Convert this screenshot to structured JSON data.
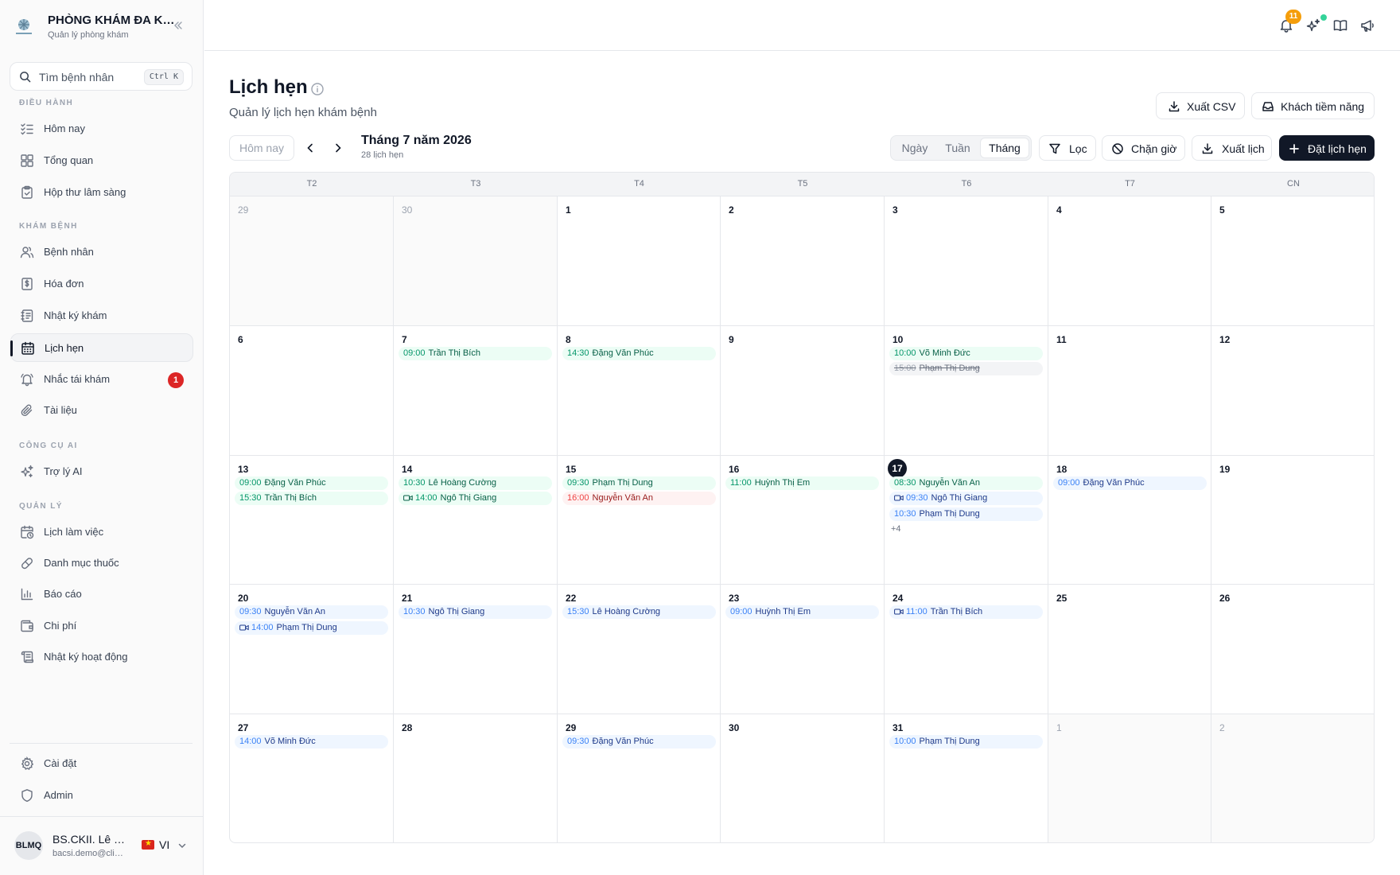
{
  "brand": {
    "title": "PHÒNG KHÁM ĐA KHOA",
    "subtitle": "Quản lý phòng khám"
  },
  "search": {
    "placeholder": "Tìm bệnh nhân",
    "shortcut": "Ctrl K"
  },
  "sidebar": {
    "sections": [
      {
        "label": "ĐIỀU HÀNH",
        "items": [
          {
            "label": "Hôm nay",
            "icon": "list-check-icon"
          },
          {
            "label": "Tổng quan",
            "icon": "dashboard-icon"
          },
          {
            "label": "Hộp thư lâm sàng",
            "icon": "clipboard-icon"
          }
        ]
      },
      {
        "label": "KHÁM BỆNH",
        "items": [
          {
            "label": "Bệnh nhân",
            "icon": "users-icon"
          },
          {
            "label": "Hóa đơn",
            "icon": "invoice-icon"
          },
          {
            "label": "Nhật ký khám",
            "icon": "notebook-icon"
          },
          {
            "label": "Lịch hẹn",
            "icon": "calendar-icon",
            "active": true
          },
          {
            "label": "Nhắc tái khám",
            "icon": "bell-icon",
            "badge": "1"
          },
          {
            "label": "Tài liệu",
            "icon": "paperclip-icon"
          }
        ]
      },
      {
        "label": "CÔNG CỤ AI",
        "items": [
          {
            "label": "Trợ lý AI",
            "icon": "sparkles-icon"
          }
        ]
      },
      {
        "label": "QUẢN LÝ",
        "items": [
          {
            "label": "Lịch làm việc",
            "icon": "calendar-clock-icon"
          },
          {
            "label": "Danh mục thuốc",
            "icon": "pill-icon"
          },
          {
            "label": "Báo cáo",
            "icon": "bar-chart-icon"
          },
          {
            "label": "Chi phí",
            "icon": "wallet-icon"
          },
          {
            "label": "Nhật ký hoạt động",
            "icon": "scroll-icon"
          }
        ]
      }
    ],
    "bottom": [
      {
        "label": "Cài đặt",
        "icon": "gear-icon"
      },
      {
        "label": "Admin",
        "icon": "shield-icon"
      }
    ]
  },
  "user": {
    "initials": "BLMQ",
    "name": "BS.CKII. Lê Minh Quân",
    "email": "bacsi.demo@clinic.vn",
    "lang": "VI"
  },
  "topbar": {
    "notification_count": "11"
  },
  "page": {
    "title": "Lịch hẹn",
    "subtitle": "Quản lý lịch hẹn khám bệnh"
  },
  "actions": {
    "export_csv": "Xuất CSV",
    "leads": "Khách tiềm năng"
  },
  "toolbar": {
    "today": "Hôm nay",
    "month_title": "Tháng 7 năm 2026",
    "count": "28 lịch hẹn",
    "views": [
      "Ngày",
      "Tuần",
      "Tháng"
    ],
    "active_view": "Tháng",
    "filter": "Lọc",
    "block": "Chặn giờ",
    "export": "Xuất lịch",
    "book": "Đặt lịch hẹn"
  },
  "colors": {
    "green": "#ecfdf5",
    "blue": "#eff6ff",
    "red": "#fef2f2",
    "gray": "#f3f4f6",
    "primary": "#111827",
    "badge": "#dc2626",
    "notify": "#f59e0b"
  },
  "calendar": {
    "weekdays": [
      "T2",
      "T3",
      "T4",
      "T5",
      "T6",
      "T7",
      "CN"
    ],
    "weeks": [
      [
        {
          "day": "29",
          "muted": true,
          "events": []
        },
        {
          "day": "30",
          "muted": true,
          "events": []
        },
        {
          "day": "1",
          "events": []
        },
        {
          "day": "2",
          "events": []
        },
        {
          "day": "3",
          "events": []
        },
        {
          "day": "4",
          "events": []
        },
        {
          "day": "5",
          "events": []
        }
      ],
      [
        {
          "day": "6",
          "events": []
        },
        {
          "day": "7",
          "events": [
            {
              "time": "09:00",
              "name": "Trần Thị Bích",
              "color": "green"
            }
          ]
        },
        {
          "day": "8",
          "events": [
            {
              "time": "14:30",
              "name": "Đặng Văn Phúc",
              "color": "green"
            }
          ]
        },
        {
          "day": "9",
          "events": []
        },
        {
          "day": "10",
          "events": [
            {
              "time": "10:00",
              "name": "Võ Minh Đức",
              "color": "green"
            },
            {
              "time": "15:00",
              "name": "Phạm Thị Dung",
              "color": "gray"
            }
          ]
        },
        {
          "day": "11",
          "events": []
        },
        {
          "day": "12",
          "events": []
        }
      ],
      [
        {
          "day": "13",
          "events": [
            {
              "time": "09:00",
              "name": "Đặng Văn Phúc",
              "color": "green"
            },
            {
              "time": "15:30",
              "name": "Trần Thị Bích",
              "color": "green"
            }
          ]
        },
        {
          "day": "14",
          "events": [
            {
              "time": "10:30",
              "name": "Lê Hoàng Cường",
              "color": "green"
            },
            {
              "time": "14:00",
              "name": "Ngô Thị Giang",
              "color": "green",
              "video": true
            }
          ]
        },
        {
          "day": "15",
          "events": [
            {
              "time": "09:30",
              "name": "Phạm Thị Dung",
              "color": "green"
            },
            {
              "time": "16:00",
              "name": "Nguyễn Văn An",
              "color": "red"
            }
          ]
        },
        {
          "day": "16",
          "events": [
            {
              "time": "11:00",
              "name": "Huỳnh Thị Em",
              "color": "green"
            }
          ]
        },
        {
          "day": "17",
          "today": true,
          "more": "+4",
          "events": [
            {
              "time": "08:30",
              "name": "Nguyễn Văn An",
              "color": "green"
            },
            {
              "time": "09:30",
              "name": "Ngô Thị Giang",
              "color": "blue",
              "video": true
            },
            {
              "time": "10:30",
              "name": "Phạm Thị Dung",
              "color": "blue"
            }
          ]
        },
        {
          "day": "18",
          "events": [
            {
              "time": "09:00",
              "name": "Đặng Văn Phúc",
              "color": "blue"
            }
          ]
        },
        {
          "day": "19",
          "events": []
        }
      ],
      [
        {
          "day": "20",
          "events": [
            {
              "time": "09:30",
              "name": "Nguyễn Văn An",
              "color": "blue"
            },
            {
              "time": "14:00",
              "name": "Phạm Thị Dung",
              "color": "blue",
              "video": true
            }
          ]
        },
        {
          "day": "21",
          "events": [
            {
              "time": "10:30",
              "name": "Ngô Thị Giang",
              "color": "blue"
            }
          ]
        },
        {
          "day": "22",
          "events": [
            {
              "time": "15:30",
              "name": "Lê Hoàng Cường",
              "color": "blue"
            }
          ]
        },
        {
          "day": "23",
          "events": [
            {
              "time": "09:00",
              "name": "Huỳnh Thị Em",
              "color": "blue"
            }
          ]
        },
        {
          "day": "24",
          "events": [
            {
              "time": "11:00",
              "name": "Trần Thị Bích",
              "color": "blue",
              "video": true
            }
          ]
        },
        {
          "day": "25",
          "events": []
        },
        {
          "day": "26",
          "events": []
        }
      ],
      [
        {
          "day": "27",
          "events": [
            {
              "time": "14:00",
              "name": "Võ Minh Đức",
              "color": "blue"
            }
          ]
        },
        {
          "day": "28",
          "events": []
        },
        {
          "day": "29",
          "events": [
            {
              "time": "09:30",
              "name": "Đặng Văn Phúc",
              "color": "blue"
            }
          ]
        },
        {
          "day": "30",
          "events": []
        },
        {
          "day": "31",
          "events": [
            {
              "time": "10:00",
              "name": "Phạm Thị Dung",
              "color": "blue"
            }
          ]
        },
        {
          "day": "1",
          "muted": true,
          "events": []
        },
        {
          "day": "2",
          "muted": true,
          "events": []
        }
      ]
    ]
  }
}
